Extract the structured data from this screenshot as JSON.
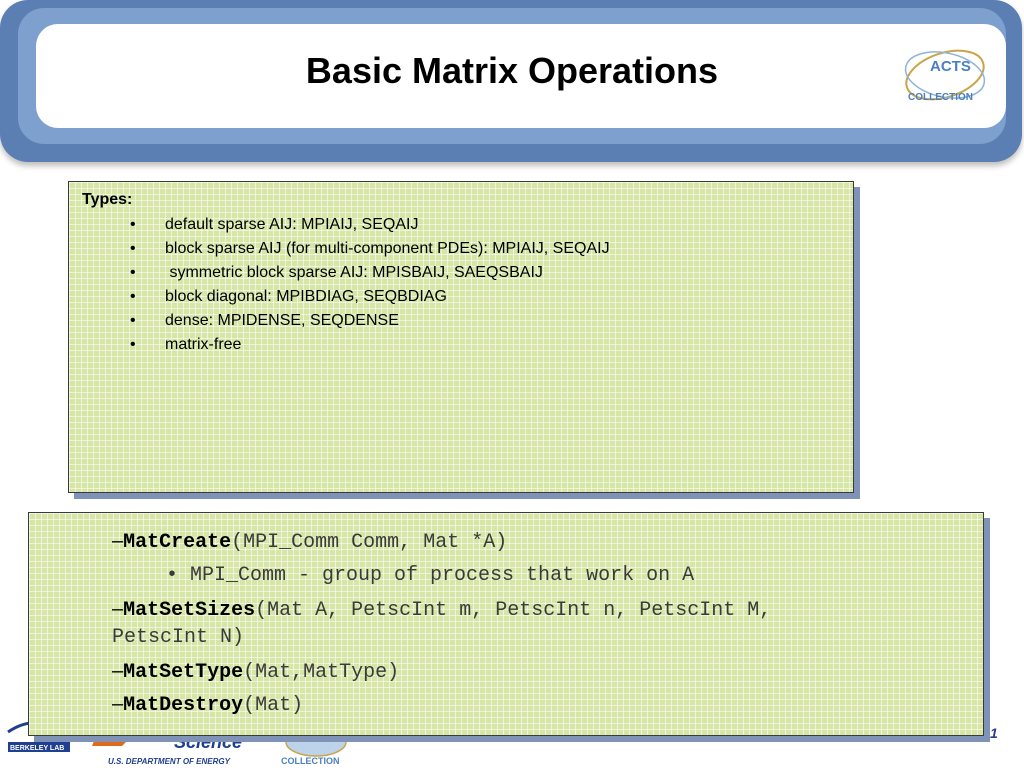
{
  "slide": {
    "title": "Basic Matrix Operations",
    "page_number": "1"
  },
  "logo": {
    "acts_top": "ACTS",
    "acts_bottom": "COLLECTION",
    "footer_lab": "BERKELEY LAB",
    "footer_science": "Science",
    "footer_doe": "U.S. DEPARTMENT OF ENERGY",
    "footer_collection": "COLLECTION"
  },
  "types_box": {
    "label": "Types:",
    "bullet": "•",
    "items": [
      "default sparse AIJ: MPIAIJ, SEQAIJ",
      "block sparse AIJ (for multi-component PDEs): MPIAIJ, SEQAIJ",
      " symmetric block sparse AIJ: MPISBAIJ, SAEQSBAIJ",
      "block diagonal: MPIBDIAG, SEQBDIAG",
      "dense: MPIDENSE, SEQDENSE",
      "matrix-free"
    ]
  },
  "functions_box": {
    "dash": "–",
    "create": {
      "name": "MatCreate",
      "args": "(MPI_Comm Comm, Mat *A)"
    },
    "create_sub": "• MPI_Comm - group of process that work on A",
    "setsizes": {
      "name": "MatSetSizes",
      "args": "(Mat A, PetscInt m, PetscInt n, PetscInt M,",
      "args_cont": "PetscInt N)"
    },
    "settype": {
      "name": "MatSetType",
      "args": "(Mat,MatType)"
    },
    "destroy": {
      "name": "MatDestroy",
      "args": "(Mat)"
    }
  },
  "colors": {
    "banner": "#5b7fb3",
    "box_green": "#d6e6a6",
    "box_shadow": "#7f93b8"
  }
}
